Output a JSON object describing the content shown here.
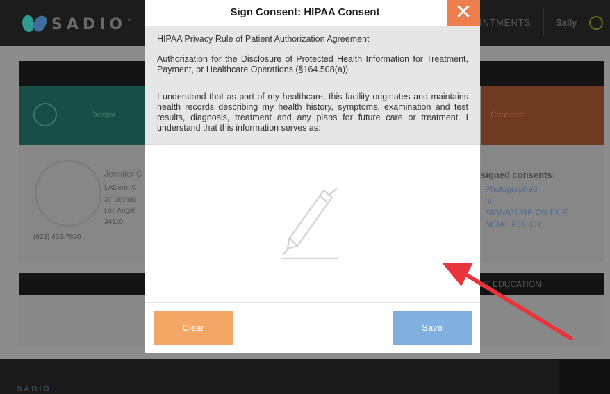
{
  "app": {
    "brand": "SADIO",
    "nav_appointments": "INTMENTS",
    "user": "Sally",
    "doctor_tab": "Doctor",
    "consents_tab": "Consents",
    "provider": {
      "name": "Jennifer C",
      "line1": "LADerm C",
      "line2": "37 Dermal",
      "line3": "Los Angel",
      "line4": "34110",
      "phone": "(623) 456-7890"
    },
    "signed_consents_title": "signed consents:",
    "signed_consents": [
      "Photographed",
      "nt",
      "SIGNATURE ON FILE",
      "NCIAL POLICY"
    ],
    "education_label": "NT EDUCATION",
    "footer_brand": "SADIO"
  },
  "modal": {
    "title": "Sign Consent: HIPAA Consent",
    "close_symbol": "✕",
    "paragraphs": [
      "HIPAA Privacy Rule of Patient Authorization Agreement",
      "Authorization for the Disclosure of Protected Health Information for Treatment, Payment, or Healthcare Operations (§164.508(a))",
      "I understand that as part of my healthcare, this facility originates and maintains health records describing my health history, symptoms, examination and test results, diagnosis, treatment and any plans for future care or treatment. I understand that this information serves as:"
    ],
    "signature_icon": "pen-icon",
    "clear_label": "Clear",
    "save_label": "Save"
  },
  "colors": {
    "close": "#ee7e4e",
    "clear": "#f2a766",
    "save": "#7fb0e0",
    "arrow": "#e8343c",
    "overlay": "#8f8f8f"
  }
}
